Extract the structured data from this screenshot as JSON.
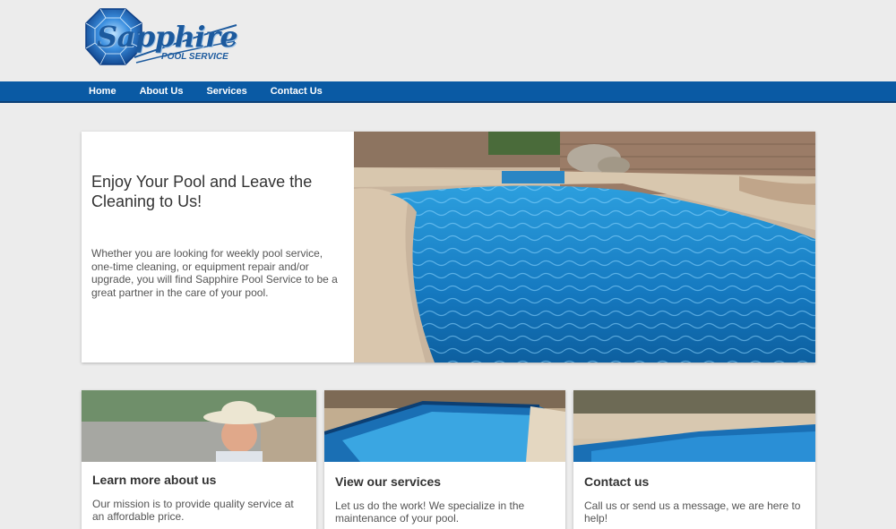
{
  "logo": {
    "title": "Sapphire",
    "subtitle": "POOL SERVICE"
  },
  "nav": {
    "items": [
      "Home",
      "About Us",
      "Services",
      "Contact Us"
    ]
  },
  "hero": {
    "title": "Enjoy Your Pool and Leave the Cleaning to Us!",
    "body": "Whether you are looking for weekly pool service, one-time cleaning, or equipment repair and/or upgrade, you will find Sapphire Pool Service to be a great partner in the care of your pool."
  },
  "cards": [
    {
      "title": "Learn more about us",
      "text": "Our mission is to provide quality service at an affordable price."
    },
    {
      "title": "View our services",
      "text": "Let us do the work! We specialize in the maintenance of your pool."
    },
    {
      "title": "Contact us",
      "text": "Call us or send us a message, we are here to help!"
    }
  ],
  "colors": {
    "nav": "#0a5aa4",
    "brand": "#1c5a9e",
    "page_bg": "#ececec",
    "pool_water": "#1f8fd0"
  }
}
